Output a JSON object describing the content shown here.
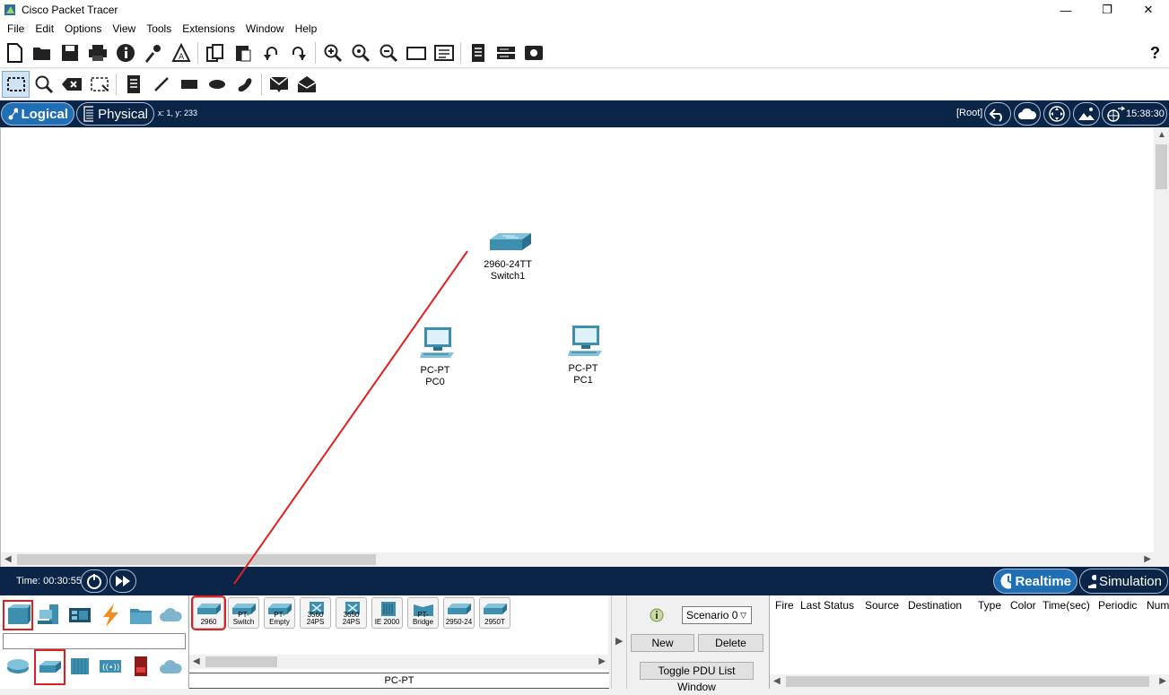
{
  "window": {
    "title": "Cisco Packet Tracer",
    "minimize": "—",
    "maximize": "❐",
    "close": "✕"
  },
  "menu": [
    "File",
    "Edit",
    "Options",
    "View",
    "Tools",
    "Extensions",
    "Window",
    "Help"
  ],
  "help_glyph": "?",
  "nav": {
    "logical": "Logical",
    "physical": "Physical",
    "coords": "x: 1, y: 233",
    "root": "[Root]",
    "clock": "15:38:30"
  },
  "devices": [
    {
      "model": "2960-24TT",
      "name": "Switch1",
      "type": "switch"
    },
    {
      "model": "PC-PT",
      "name": "PC0",
      "type": "pc"
    },
    {
      "model": "PC-PT",
      "name": "PC1",
      "type": "pc"
    }
  ],
  "sim": {
    "time_label": "Time: 00:30:55",
    "realtime": "Realtime",
    "simulation": "Simulation"
  },
  "device_models": [
    "2960",
    "PT-Switch",
    "PT-Empty",
    "3560\n24PS",
    "3650\n24PS",
    "IE 2000",
    "PT-Bridge",
    "2950-24",
    "2950T"
  ],
  "selected_model_label": "PC-PT",
  "scenario": {
    "selected": "Scenario 0",
    "new": "New",
    "delete": "Delete",
    "toggle": "Toggle PDU List Window"
  },
  "pdu_columns": [
    "Fire",
    "Last Status",
    "Source",
    "Destination",
    "Type",
    "Color",
    "Time(sec)",
    "Periodic",
    "Num"
  ],
  "colors": {
    "nav_bg": "#0b2548",
    "active_pill": "#1f6fb7",
    "device_blue": "#3d8fb0",
    "annotation_red": "#e02020"
  }
}
